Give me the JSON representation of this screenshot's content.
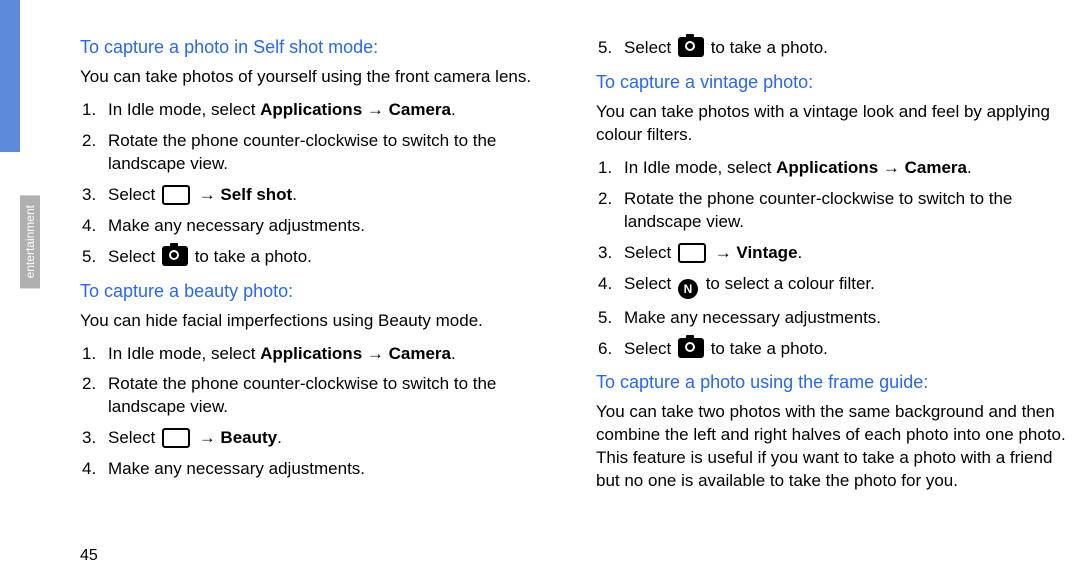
{
  "sidebar": {
    "label": "entertainment"
  },
  "pageNumber": "45",
  "col1": {
    "section1": {
      "heading": "To capture a photo in Self shot mode:",
      "intro": "You can take photos of yourself using the front camera lens.",
      "steps": {
        "s1_pre": "In Idle mode, select ",
        "s1_bold": "Applications → Camera",
        "s1_post": ".",
        "s2": "Rotate the phone counter-clockwise to switch to the landscape view.",
        "s3_pre": "Select ",
        "s3_bold": " → Self shot",
        "s3_post": ".",
        "s4": "Make any necessary adjustments.",
        "s5_pre": "Select ",
        "s5_post": " to take a photo."
      }
    },
    "section2": {
      "heading": "To capture a beauty photo:",
      "intro": "You can hide facial imperfections using Beauty mode.",
      "steps": {
        "s1_pre": "In Idle mode, select ",
        "s1_bold": "Applications → Camera",
        "s1_post": ".",
        "s2": "Rotate the phone counter-clockwise to switch to the landscape view.",
        "s3_pre": "Select ",
        "s3_bold": " → Beauty",
        "s3_post": ".",
        "s4": "Make any necessary adjustments."
      }
    }
  },
  "col2": {
    "section0": {
      "s5_pre": "Select ",
      "s5_post": " to take a photo."
    },
    "section1": {
      "heading": "To capture a vintage photo:",
      "intro": "You can take photos with a vintage look and feel by applying colour filters.",
      "steps": {
        "s1_pre": "In Idle mode, select ",
        "s1_bold": "Applications → Camera",
        "s1_post": ".",
        "s2": "Rotate the phone counter-clockwise to switch to the landscape view.",
        "s3_pre": "Select ",
        "s3_bold": " → Vintage",
        "s3_post": ".",
        "s4_pre": "Select ",
        "s4_post": " to select a colour filter.",
        "s5": "Make any necessary adjustments.",
        "s6_pre": "Select ",
        "s6_post": " to take a photo."
      }
    },
    "section2": {
      "heading": "To capture a photo using the frame guide:",
      "intro": "You can take two photos with the same background and then combine the left and right halves of each photo into one photo. This feature is useful if you want to take a photo with a friend but no one is available to take the photo for you."
    }
  },
  "nums": {
    "n1": "1.",
    "n2": "2.",
    "n3": "3.",
    "n4": "4.",
    "n5": "5.",
    "n6": "6."
  },
  "nfilter": "N"
}
